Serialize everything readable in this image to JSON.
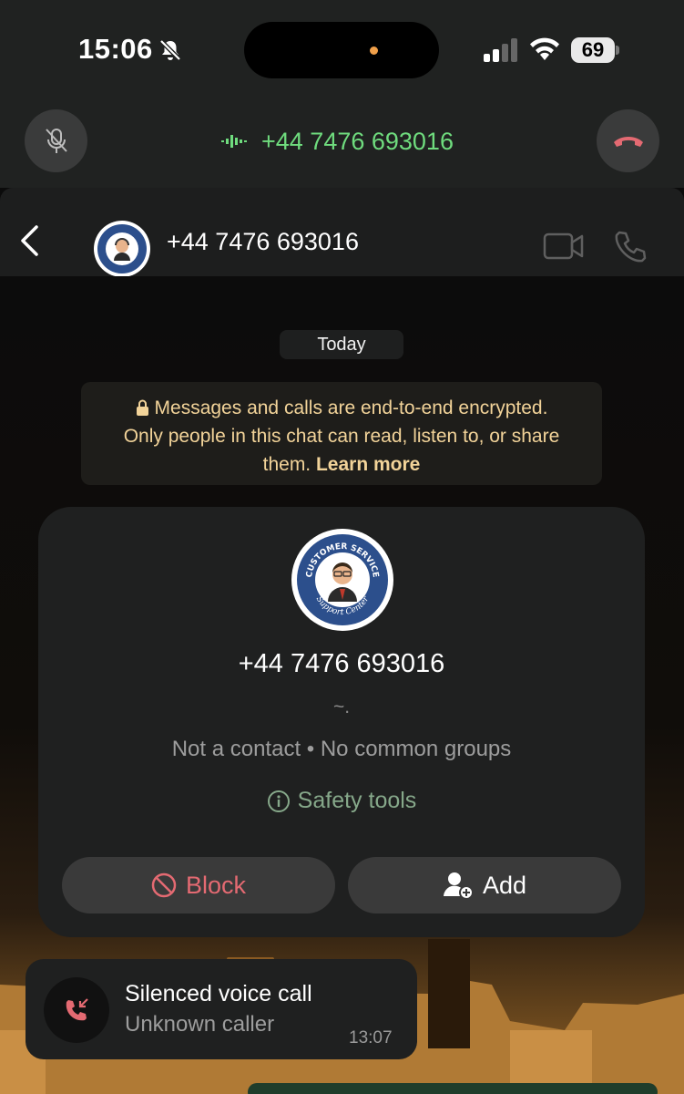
{
  "status_bar": {
    "time": "15:06",
    "battery": "69",
    "icons": [
      "bell-slash-icon",
      "cellular-signal-icon",
      "wifi-icon",
      "battery-icon"
    ]
  },
  "call_bar": {
    "number": "+44 7476 693016",
    "accent": "#6fdc7e",
    "end_color": "#e46a72",
    "icons": [
      "mute-microphone-icon",
      "audio-wave-icon",
      "end-call-icon"
    ]
  },
  "chat_header": {
    "title": "+44 7476 693016",
    "avatar": "customer-service-logo",
    "icons": [
      "back-chevron-icon",
      "video-call-icon",
      "voice-call-icon"
    ]
  },
  "chat": {
    "date_chip": "Today",
    "encryption_notice": {
      "line1": "Messages and calls are end-to-end encrypted.",
      "line2": "Only people in this chat can read, listen to, or share",
      "line3_prefix": "them. ",
      "link": "Learn more",
      "color": "#f2d399"
    },
    "contact_card": {
      "number": "+44 7476 693016",
      "about": "~.",
      "meta": "Not a contact • No common groups",
      "safety_label": "Safety tools",
      "block_label": "Block",
      "add_label": "Add",
      "avatar_logo": {
        "top_text": "CUSTOMER SERVICE",
        "bottom_text": "Support Center"
      }
    },
    "call_event": {
      "title": "Silenced voice call",
      "subtitle": "Unknown caller",
      "time": "13:07"
    }
  }
}
